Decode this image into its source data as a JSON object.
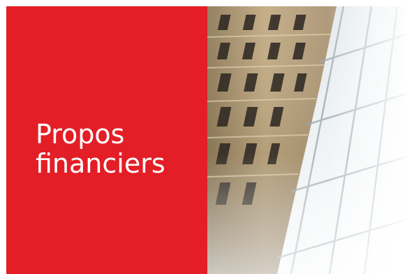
{
  "banner": {
    "title_line1": "Propos",
    "title_line2": "financiers",
    "image_label": "building-facade-image"
  },
  "colors": {
    "accent_red": "#e31e26",
    "text": "#ffffff",
    "stone": "#b9a27c",
    "glass": "#dfe7ec"
  }
}
